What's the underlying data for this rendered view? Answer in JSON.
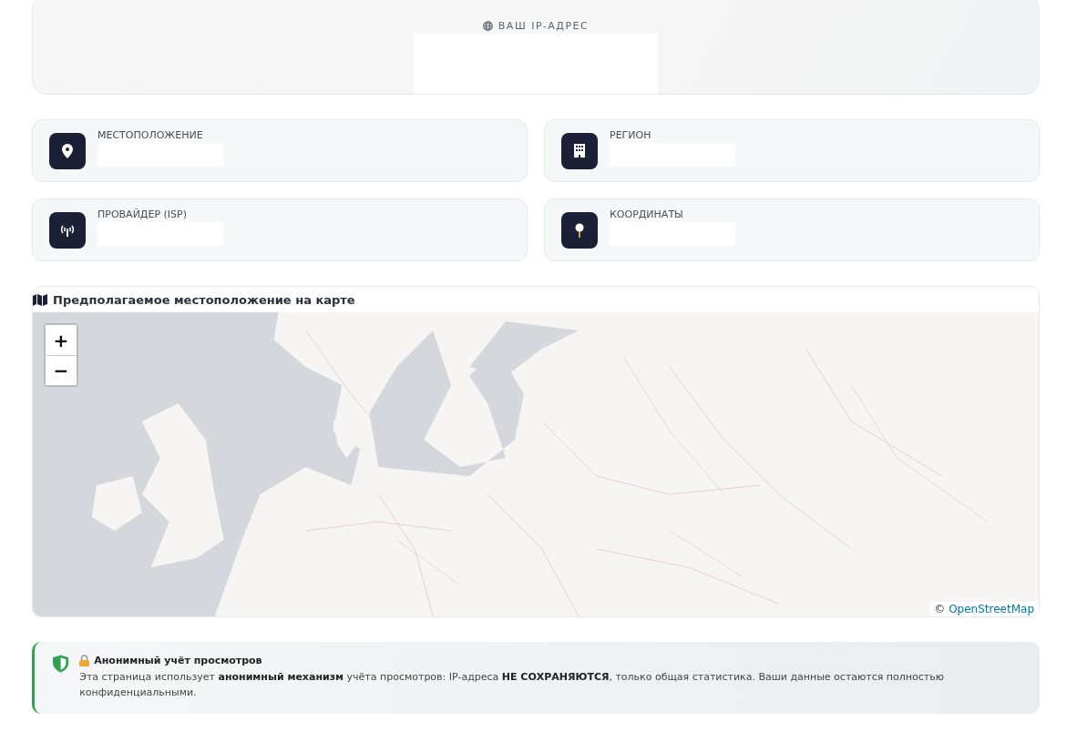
{
  "ip_card": {
    "label": "ВАШ IP-АДРЕС"
  },
  "info_cards": [
    {
      "kind": "location",
      "label": "МЕСТОПОЛОЖЕНИЕ"
    },
    {
      "kind": "region",
      "label": "РЕГИОН"
    },
    {
      "kind": "isp",
      "label": "ПРОВАЙДЕР (ISP)"
    },
    {
      "kind": "coordinates",
      "label": "КООРДИНАТЫ"
    }
  ],
  "map": {
    "title": "Предполагаемое местоположение на карте",
    "zoom_in": "+",
    "zoom_out": "−",
    "attribution_prefix": "©",
    "attribution_link": "OpenStreetMap"
  },
  "notice": {
    "title": "Анонимный учёт просмотров",
    "text": "Эта страница использует **анонимный механизм** учёта просмотров: IP-адреса **НЕ СОХРАНЯЮТСЯ**, только общая статистика. Ваши данные остаются полностью конфиденциальными."
  }
}
